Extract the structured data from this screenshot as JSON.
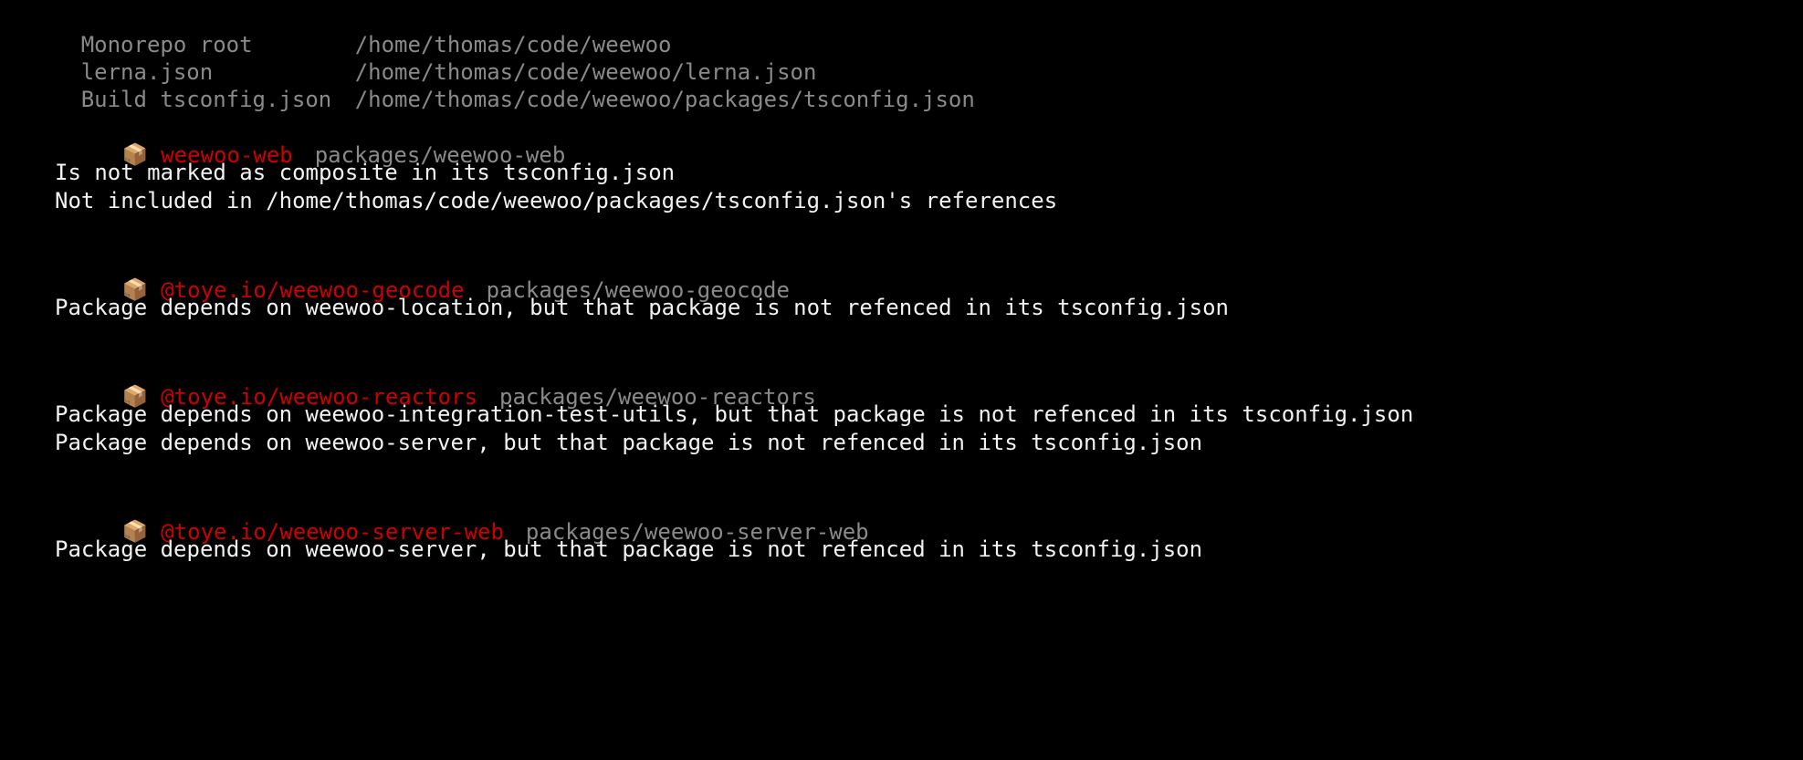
{
  "terminal": {
    "background_color": "#000000",
    "muted_color": "#8a8a8a",
    "package_name_color": "#cc0000",
    "message_color": "#f2f2f2"
  },
  "summary": {
    "rows": [
      {
        "label": "Monorepo root",
        "path": "/home/thomas/code/weewoo"
      },
      {
        "label": "lerna.json",
        "path": "/home/thomas/code/weewoo/lerna.json"
      },
      {
        "label": "Build tsconfig.json",
        "path": "/home/thomas/code/weewoo/packages/tsconfig.json"
      }
    ]
  },
  "packages": [
    {
      "icon": "package-icon",
      "icon_glyph": "📦",
      "name": "weewoo-web",
      "path": "packages/weewoo-web",
      "messages": [
        "Is not marked as composite in its tsconfig.json",
        "Not included in /home/thomas/code/weewoo/packages/tsconfig.json's references"
      ]
    },
    {
      "icon": "package-icon",
      "icon_glyph": "📦",
      "name": "@toye.io/weewoo-geocode",
      "path": "packages/weewoo-geocode",
      "messages": [
        "Package depends on weewoo-location, but that package is not refenced in its tsconfig.json"
      ]
    },
    {
      "icon": "package-icon",
      "icon_glyph": "📦",
      "name": "@toye.io/weewoo-reactors",
      "path": "packages/weewoo-reactors",
      "messages": [
        "Package depends on weewoo-integration-test-utils, but that package is not refenced in its tsconfig.json",
        "Package depends on weewoo-server, but that package is not refenced in its tsconfig.json"
      ]
    },
    {
      "icon": "package-icon",
      "icon_glyph": "📦",
      "name": "@toye.io/weewoo-server-web",
      "path": "packages/weewoo-server-web",
      "messages": [
        "Package depends on weewoo-server, but that package is not refenced in its tsconfig.json"
      ]
    }
  ]
}
